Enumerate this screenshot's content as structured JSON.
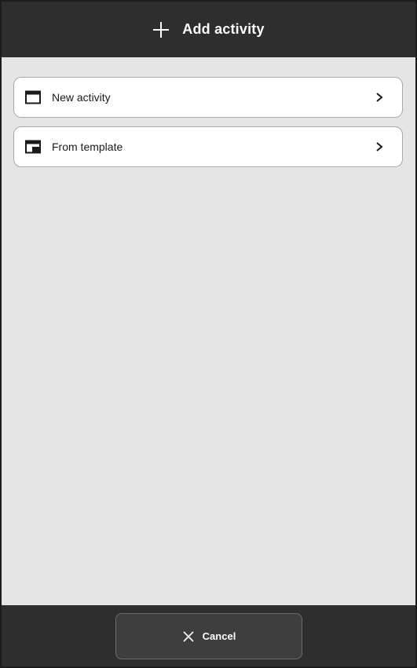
{
  "header": {
    "title": "Add activity",
    "icon": "plus-icon"
  },
  "menu": {
    "items": [
      {
        "label": "New activity",
        "icon": "calendar-icon",
        "trailing_icon": "chevron-right-icon"
      },
      {
        "label": "From template",
        "icon": "calendar-template-icon",
        "trailing_icon": "chevron-right-icon"
      }
    ]
  },
  "footer": {
    "cancel_label": "Cancel",
    "cancel_icon": "close-icon"
  },
  "colors": {
    "header_bg": "#2e2e2e",
    "content_bg": "#e5e5e5",
    "card_bg": "#ffffff",
    "text": "#1a1a1a"
  }
}
